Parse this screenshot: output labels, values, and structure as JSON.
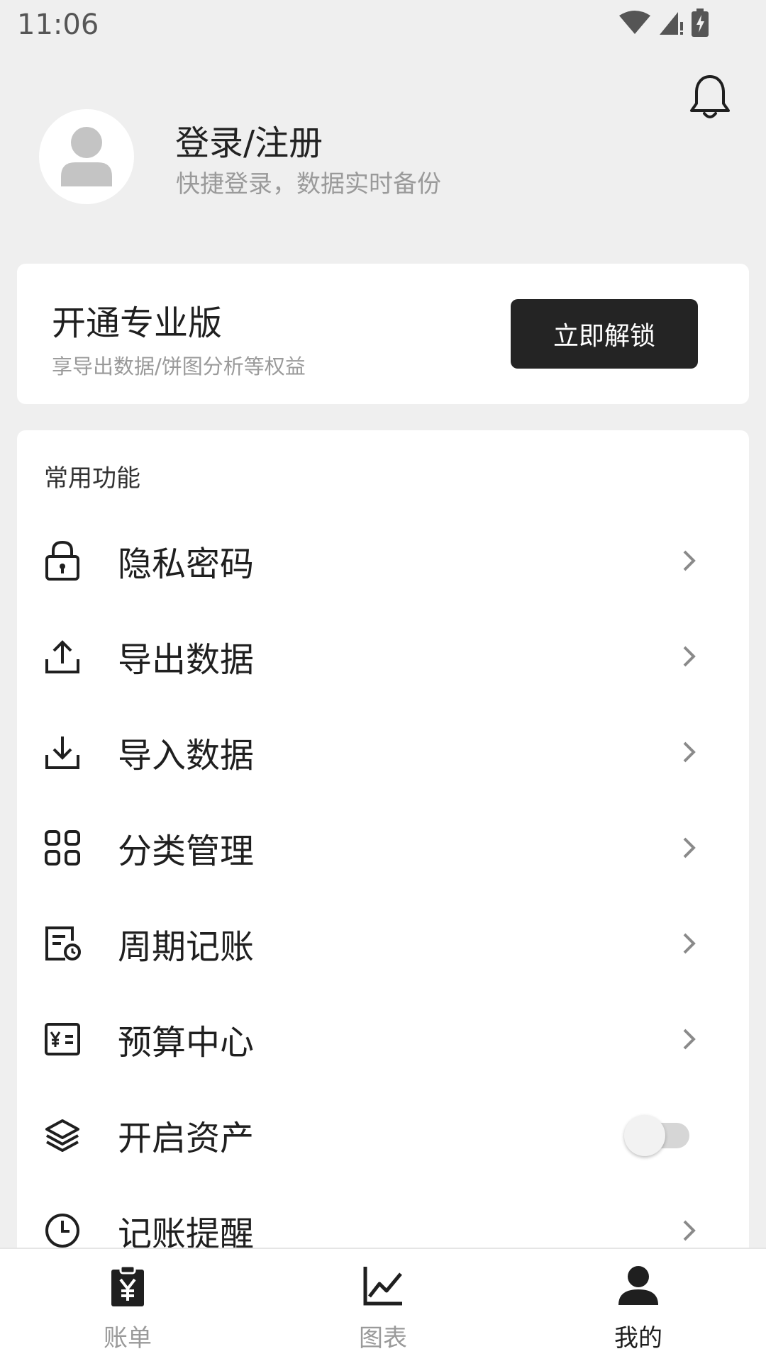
{
  "status_bar": {
    "time": "11:06"
  },
  "profile": {
    "title": "登录/注册",
    "subtitle": "快捷登录，数据实时备份"
  },
  "pro_card": {
    "title": "开通专业版",
    "subtitle": "享导出数据/饼图分析等权益",
    "button_label": "立即解锁"
  },
  "functions": {
    "section_title": "常用功能",
    "items": [
      {
        "label": "隐私密码",
        "icon": "lock-icon",
        "control": "chevron"
      },
      {
        "label": "导出数据",
        "icon": "upload-icon",
        "control": "chevron"
      },
      {
        "label": "导入数据",
        "icon": "download-icon",
        "control": "chevron"
      },
      {
        "label": "分类管理",
        "icon": "grid-icon",
        "control": "chevron"
      },
      {
        "label": "周期记账",
        "icon": "recurring-bill-icon",
        "control": "chevron"
      },
      {
        "label": "预算中心",
        "icon": "budget-icon",
        "control": "chevron"
      },
      {
        "label": "开启资产",
        "icon": "layers-icon",
        "control": "toggle",
        "toggle_on": false
      },
      {
        "label": "记账提醒",
        "icon": "clock-icon",
        "control": "chevron"
      }
    ]
  },
  "bottom_nav": {
    "items": [
      {
        "label": "账单",
        "icon": "bill-icon",
        "active": false
      },
      {
        "label": "图表",
        "icon": "chart-icon",
        "active": false
      },
      {
        "label": "我的",
        "icon": "person-icon",
        "active": true
      }
    ]
  },
  "colors": {
    "background": "#efefef",
    "card": "#ffffff",
    "button_dark": "#242424",
    "nav_active": "#1f1f1f",
    "nav_inactive": "#9a9a9a"
  }
}
